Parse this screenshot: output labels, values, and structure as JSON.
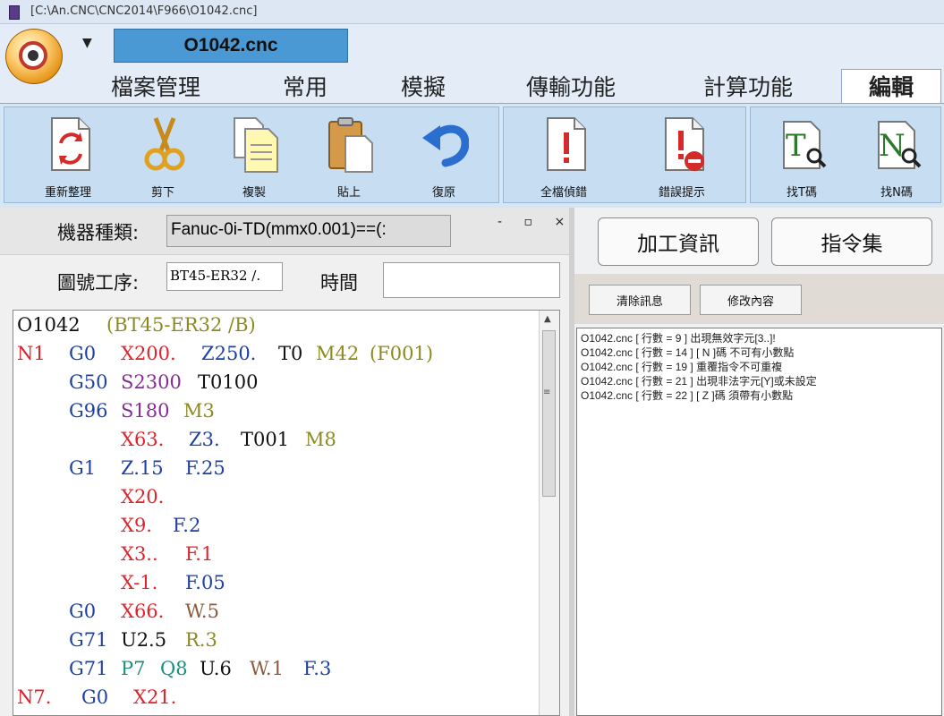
{
  "window": {
    "title": "[C:\\An.CNC\\CNC2014\\F966\\O1042.cnc]"
  },
  "header": {
    "file_name": "O1042.cnc",
    "qat_arrow": "▼"
  },
  "tabs": [
    {
      "label": "檔案管理"
    },
    {
      "label": "常用"
    },
    {
      "label": "模擬"
    },
    {
      "label": "傳輸功能"
    },
    {
      "label": "計算功能"
    },
    {
      "label": "編輯",
      "active": true
    }
  ],
  "ribbon": {
    "buttons": [
      {
        "label": "重新整理",
        "icon": "refresh-icon"
      },
      {
        "label": "剪下",
        "icon": "scissors-icon"
      },
      {
        "label": "複製",
        "icon": "copy-icon"
      },
      {
        "label": "貼上",
        "icon": "paste-icon"
      },
      {
        "label": "復原",
        "icon": "undo-icon"
      },
      {
        "label": "全檔偵錯",
        "icon": "document-exclamation-icon"
      },
      {
        "label": "錯誤提示",
        "icon": "error-hint-icon"
      },
      {
        "label": "找T碼",
        "icon": "find-t-icon",
        "glyph": "T"
      },
      {
        "label": "找N碼",
        "icon": "find-n-icon",
        "glyph": "N"
      }
    ]
  },
  "left": {
    "machine_label": "機器種類:",
    "machine_value": "Fanuc-0i-TD(mmx0.001)==(:",
    "pane_controls": "- ▫ ×",
    "drawing_label": "圖號工序:",
    "drawing_value": "BT45-ER32 /.",
    "time_label": "時間",
    "time_value": "",
    "scroll_up": "▲",
    "scroll_grip": "≡"
  },
  "colors": {
    "black": "#111111",
    "red": "#e0232b",
    "blue": "#1d3fa8",
    "olive": "#8c8a1e",
    "purple": "#8a2a9a",
    "teal": "#18907e",
    "brown": "#8a5a3a"
  },
  "code": {
    "lines": [
      [
        {
          "t": "O1042",
          "c": "black"
        },
        {
          "t": "(BT45-ER32 /B)",
          "c": "olive"
        }
      ],
      [
        {
          "t": "N1",
          "c": "red"
        },
        {
          "t": "G0",
          "c": "blue"
        },
        {
          "t": "X200.",
          "c": "red"
        },
        {
          "t": "Z250.",
          "c": "blue"
        },
        {
          "t": "T0",
          "c": "black"
        },
        {
          "t": "M42",
          "c": "olive"
        },
        {
          "t": "(F001)",
          "c": "olive"
        }
      ],
      [
        {
          "t": "G50",
          "c": "blue"
        },
        {
          "t": "S2300",
          "c": "purple"
        },
        {
          "t": "T0100",
          "c": "black"
        }
      ],
      [
        {
          "t": "G96",
          "c": "blue"
        },
        {
          "t": "S180",
          "c": "purple"
        },
        {
          "t": "M3",
          "c": "olive"
        }
      ],
      [
        {
          "t": "X63.",
          "c": "red"
        },
        {
          "t": "Z3.",
          "c": "blue"
        },
        {
          "t": "T001",
          "c": "black"
        },
        {
          "t": "M8",
          "c": "olive"
        }
      ],
      [
        {
          "t": "G1",
          "c": "blue"
        },
        {
          "t": "Z.15",
          "c": "blue"
        },
        {
          "t": "F.25",
          "c": "blue"
        }
      ],
      [
        {
          "t": "X20.",
          "c": "red"
        }
      ],
      [
        {
          "t": "X9.",
          "c": "red"
        },
        {
          "t": "F.2",
          "c": "blue"
        }
      ],
      [
        {
          "t": "X3..",
          "c": "red"
        },
        {
          "t": "F.1",
          "c": "red"
        }
      ],
      [
        {
          "t": "X-1.",
          "c": "red"
        },
        {
          "t": "F.05",
          "c": "blue"
        }
      ],
      [
        {
          "t": "G0",
          "c": "blue"
        },
        {
          "t": "X66.",
          "c": "red"
        },
        {
          "t": "W.5",
          "c": "brown"
        }
      ],
      [
        {
          "t": "G71",
          "c": "blue"
        },
        {
          "t": "U2.5",
          "c": "black"
        },
        {
          "t": "R.3",
          "c": "olive"
        }
      ],
      [
        {
          "t": "G71",
          "c": "blue"
        },
        {
          "t": "P7",
          "c": "teal"
        },
        {
          "t": "Q8",
          "c": "teal"
        },
        {
          "t": "U.6",
          "c": "black"
        },
        {
          "t": "W.1",
          "c": "brown"
        },
        {
          "t": "F.3",
          "c": "blue"
        }
      ],
      [
        {
          "t": "N7.",
          "c": "red"
        },
        {
          "t": "G0",
          "c": "blue"
        },
        {
          "t": "X21.",
          "c": "red"
        }
      ]
    ]
  },
  "right": {
    "tabs": [
      {
        "label": "加工資訊"
      },
      {
        "label": "指令集"
      }
    ],
    "buttons": [
      {
        "label": "清除訊息"
      },
      {
        "label": "修改內容"
      }
    ],
    "messages": [
      "O1042.cnc [ 行數 = 9 ] 出現無效字元[3..]!",
      "O1042.cnc [ 行數 = 14 ] [ N ]碼 不可有小數點",
      "O1042.cnc [ 行數 = 19 ] 重覆指令不可重複",
      "O1042.cnc [ 行數 = 21 ] 出現非法字元[Y]或未設定",
      "O1042.cnc [ 行數 = 22 ] [ Z ]碼 須帶有小數點"
    ]
  }
}
